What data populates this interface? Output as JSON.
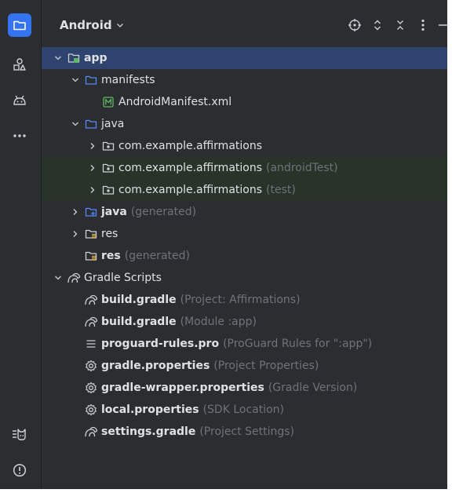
{
  "header": {
    "title": "Android"
  },
  "tree": [
    {
      "level": 0,
      "expand": "open",
      "icon": "module-folder-icon",
      "label": "app",
      "bold": true,
      "hint": "",
      "state": "selected"
    },
    {
      "level": 1,
      "expand": "open",
      "icon": "folder-icon",
      "label": "manifests",
      "bold": false,
      "hint": "",
      "state": ""
    },
    {
      "level": 2,
      "expand": "none",
      "icon": "manifest-file-icon",
      "label": "AndroidManifest.xml",
      "bold": false,
      "hint": "",
      "state": ""
    },
    {
      "level": 1,
      "expand": "open",
      "icon": "folder-icon",
      "label": "java",
      "bold": false,
      "hint": "",
      "state": ""
    },
    {
      "level": 2,
      "expand": "closed",
      "icon": "package-icon",
      "label": "com.example.affirmations",
      "bold": false,
      "hint": "",
      "state": ""
    },
    {
      "level": 2,
      "expand": "closed",
      "icon": "package-icon",
      "label": "com.example.affirmations",
      "bold": false,
      "hint": "(androidTest)",
      "state": "tinted"
    },
    {
      "level": 2,
      "expand": "closed",
      "icon": "package-icon",
      "label": "com.example.affirmations",
      "bold": false,
      "hint": "(test)",
      "state": "tinted"
    },
    {
      "level": 1,
      "expand": "closed",
      "icon": "generated-source-folder-icon",
      "label": "java",
      "bold": true,
      "hint": "(generated)",
      "state": ""
    },
    {
      "level": 1,
      "expand": "closed",
      "icon": "resource-folder-icon",
      "label": "res",
      "bold": false,
      "hint": "",
      "state": ""
    },
    {
      "level": 1,
      "expand": "none",
      "icon": "resource-folder-icon",
      "label": "res",
      "bold": true,
      "hint": "(generated)",
      "state": ""
    },
    {
      "level": 0,
      "expand": "open",
      "icon": "gradle-icon",
      "label": "Gradle Scripts",
      "bold": false,
      "hint": "",
      "state": ""
    },
    {
      "level": 1,
      "expand": "none",
      "icon": "gradle-icon",
      "label": "build.gradle",
      "bold": true,
      "hint": "(Project: Affirmations)",
      "state": ""
    },
    {
      "level": 1,
      "expand": "none",
      "icon": "gradle-icon",
      "label": "build.gradle",
      "bold": true,
      "hint": "(Module :app)",
      "state": ""
    },
    {
      "level": 1,
      "expand": "none",
      "icon": "text-file-icon",
      "label": "proguard-rules.pro",
      "bold": true,
      "hint": "(ProGuard Rules for \":app\")",
      "state": ""
    },
    {
      "level": 1,
      "expand": "none",
      "icon": "settings-gear-icon",
      "label": "gradle.properties",
      "bold": true,
      "hint": "(Project Properties)",
      "state": ""
    },
    {
      "level": 1,
      "expand": "none",
      "icon": "settings-gear-icon",
      "label": "gradle-wrapper.properties",
      "bold": true,
      "hint": "(Gradle Version)",
      "state": ""
    },
    {
      "level": 1,
      "expand": "none",
      "icon": "settings-gear-icon",
      "label": "local.properties",
      "bold": true,
      "hint": "(SDK Location)",
      "state": ""
    },
    {
      "level": 1,
      "expand": "none",
      "icon": "gradle-icon",
      "label": "settings.gradle",
      "bold": true,
      "hint": "(Project Settings)",
      "state": ""
    }
  ],
  "colors": {
    "background": "#2b2d30",
    "selected": "#2e436e",
    "tinted": "#283329",
    "accent": "#3574f0",
    "text": "#dfe1e5",
    "hint": "#6f737a"
  }
}
